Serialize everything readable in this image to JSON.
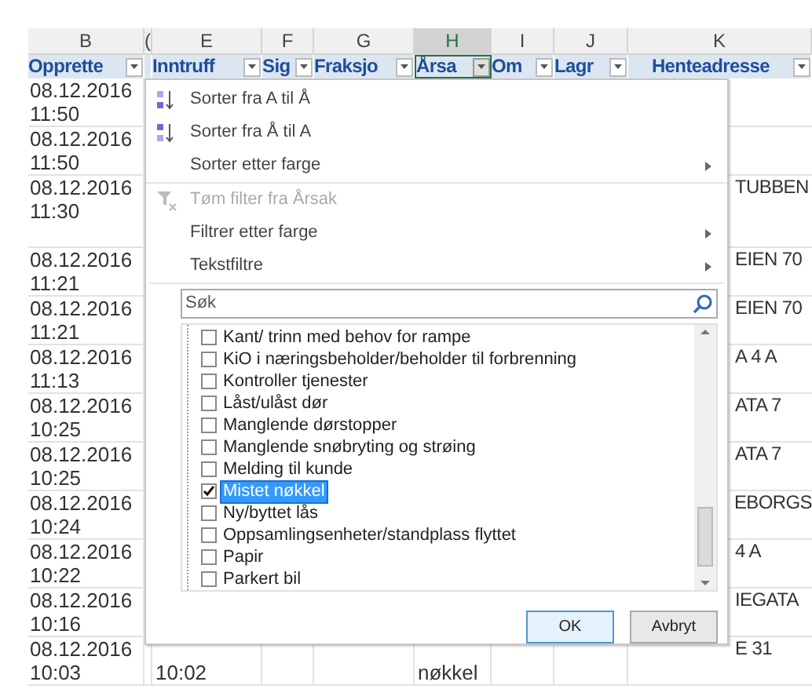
{
  "columns": [
    {
      "letter": "B",
      "filter": "Opprette",
      "selected": false
    },
    {
      "letter": "(",
      "selected": false
    },
    {
      "letter": "E",
      "filter": "Inntruff",
      "selected": false
    },
    {
      "letter": "F",
      "filter": "Sig",
      "selected": false
    },
    {
      "letter": "G",
      "filter": "Fraksjo",
      "selected": false
    },
    {
      "letter": "H",
      "filter": "Årsa",
      "selected": true
    },
    {
      "letter": "I",
      "filter": "Om",
      "selected": false
    },
    {
      "letter": "J",
      "filter": "Lagr",
      "selected": false
    },
    {
      "letter": "K",
      "filter": "Henteadresse",
      "selected": false
    }
  ],
  "rows": [
    {
      "date": "08.12.2016",
      "time": "11:50",
      "tall": false
    },
    {
      "date": "08.12.2016",
      "time": "11:50",
      "tall": false
    },
    {
      "date": "08.12.2016",
      "time": "11:30",
      "k": "TUBBEN",
      "tall": true
    },
    {
      "date": "08.12.2016",
      "time": "11:21",
      "k": "EIEN 70",
      "tall": false
    },
    {
      "date": "08.12.2016",
      "time": "11:21",
      "k": "EIEN 70",
      "tall": false
    },
    {
      "date": "08.12.2016",
      "time": "11:13",
      "k": "A 4 A",
      "tall": false
    },
    {
      "date": "08.12.2016",
      "time": "10:25",
      "k": "ATA 7",
      "tall": false
    },
    {
      "date": "08.12.2016",
      "time": "10:25",
      "k": "ATA 7",
      "tall": false
    },
    {
      "date": "08.12.2016",
      "time": "10:24",
      "k": "EBORGS",
      "tall": false
    },
    {
      "date": "08.12.2016",
      "time": "10:22",
      "k": "4 A",
      "tall": false
    },
    {
      "date": "08.12.2016",
      "time": "10:16",
      "k": "IEGATA",
      "tall": false
    },
    {
      "date": "08.12.2016",
      "time": "10:03",
      "e": "10:02",
      "h": "nøkkel",
      "k": "E 31",
      "tall": false
    }
  ],
  "filter_menu": {
    "items": [
      {
        "kind": "sort-asc",
        "label": "Sorter fra A til Å",
        "disabled": false,
        "submenu": false
      },
      {
        "kind": "sort-desc",
        "label": "Sorter fra Å til A",
        "disabled": false,
        "submenu": false
      },
      {
        "kind": "plain",
        "label": "Sorter etter farge",
        "disabled": false,
        "submenu": true
      },
      {
        "kind": "clear",
        "label": "Tøm filter fra Årsak",
        "disabled": true,
        "submenu": false
      },
      {
        "kind": "plain",
        "label": "Filtrer etter farge",
        "disabled": false,
        "submenu": true
      },
      {
        "kind": "plain",
        "label": "Tekstfiltre",
        "disabled": false,
        "submenu": true
      }
    ],
    "search": {
      "placeholder": "Søk"
    },
    "values": [
      {
        "label": "Kant/ trinn med behov for rampe",
        "checked": false,
        "selected": false
      },
      {
        "label": "KiO i næringsbeholder/beholder til forbrenning",
        "checked": false,
        "selected": false
      },
      {
        "label": "Kontroller tjenester",
        "checked": false,
        "selected": false
      },
      {
        "label": "Låst/ulåst dør",
        "checked": false,
        "selected": false
      },
      {
        "label": "Manglende dørstopper",
        "checked": false,
        "selected": false
      },
      {
        "label": "Manglende snøbryting og strøing",
        "checked": false,
        "selected": false
      },
      {
        "label": "Melding til kunde",
        "checked": false,
        "selected": false
      },
      {
        "label": "Mistet nøkkel",
        "checked": true,
        "selected": true
      },
      {
        "label": "Ny/byttet lås",
        "checked": false,
        "selected": false
      },
      {
        "label": "Oppsamlingsenheter/standplass flyttet",
        "checked": false,
        "selected": false
      },
      {
        "label": "Papir",
        "checked": false,
        "selected": false
      },
      {
        "label": "Parkert bil",
        "checked": false,
        "selected": false
      }
    ],
    "buttons": [
      "OK",
      "Avbryt"
    ]
  }
}
